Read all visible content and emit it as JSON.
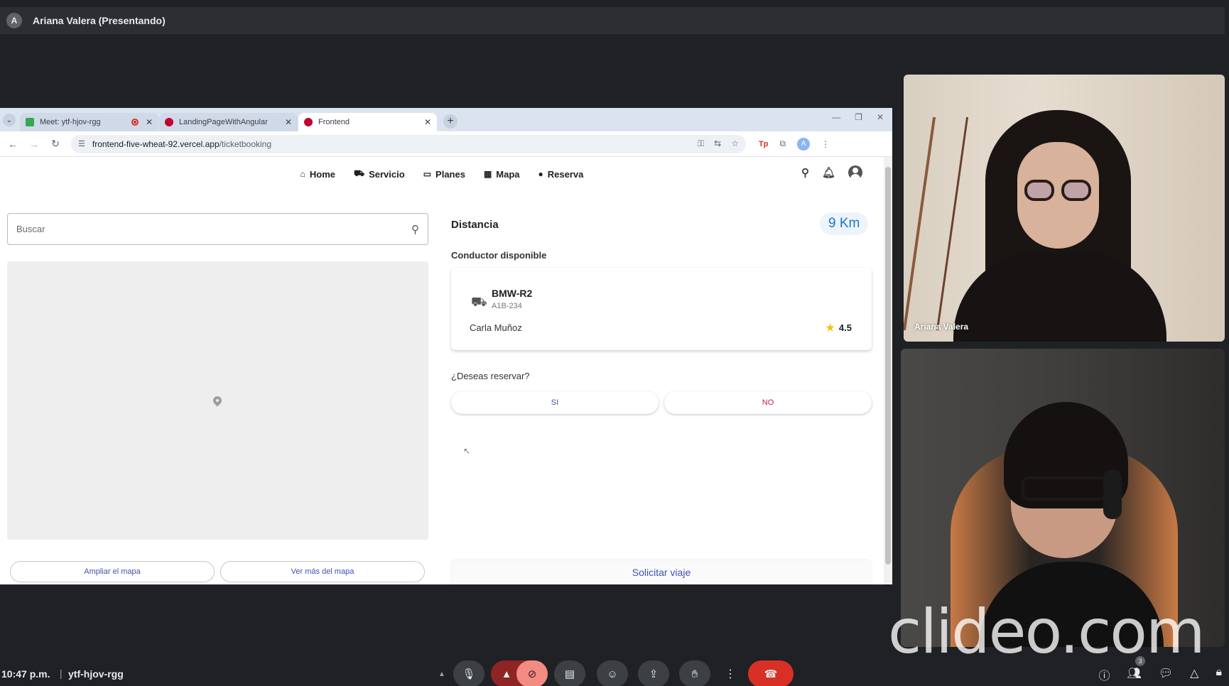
{
  "presenter": {
    "initial": "A",
    "label": "Ariana Valera (Presentando)"
  },
  "browser": {
    "tabs": [
      {
        "title": "Meet: ytf-hjov-rgg",
        "favicon": "meet-icon",
        "recording": true
      },
      {
        "title": "LandingPageWithAngular",
        "favicon": "angular-icon"
      },
      {
        "title": "Frontend",
        "favicon": "angular-icon",
        "active": true
      }
    ],
    "url_host": "frontend-five-wheat-92.vercel.app",
    "url_path": "/ticketbooking",
    "profile_initial": "A",
    "extension_label": "Tp"
  },
  "app": {
    "nav": [
      {
        "label": "Home",
        "icon": "home-icon"
      },
      {
        "label": "Servicio",
        "icon": "car-icon"
      },
      {
        "label": "Planes",
        "icon": "monitor-icon"
      },
      {
        "label": "Mapa",
        "icon": "map-icon"
      },
      {
        "label": "Reserva",
        "icon": "person-icon"
      }
    ],
    "search_placeholder": "Buscar",
    "map_buttons": {
      "expand": "Ampliar el mapa",
      "more": "Ver más del mapa"
    },
    "distance": {
      "label": "Distancia",
      "value": "9 Km"
    },
    "driver_section_label": "Conductor disponible",
    "driver": {
      "car_model": "BMW-R2",
      "plate": "A1B-234",
      "name": "Carla Muñoz",
      "rating": "4.5"
    },
    "reserve_question": "¿Deseas reservar?",
    "reserve_yes": "SI",
    "reserve_no": "NO",
    "request_label": "Solicitar viaje"
  },
  "participants": [
    {
      "name": "Ariana Valera"
    }
  ],
  "watermark": "clideo.com",
  "meeting": {
    "time": "10:47 p.m.",
    "separator": "|",
    "code": "ytf-hjov-rgg",
    "participant_count": "3"
  },
  "colors": {
    "accent": "#3f51b5",
    "no_button": "#c2185b",
    "end_call": "#d93025",
    "distance_chip": "#1976d2"
  }
}
